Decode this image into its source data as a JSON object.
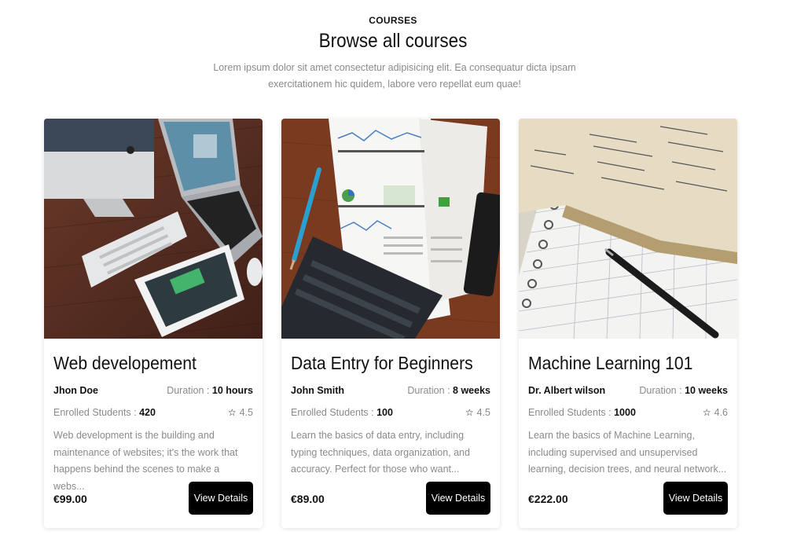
{
  "header": {
    "eyebrow": "COURSES",
    "title": "Browse all courses",
    "subtitle": "Lorem ipsum dolor sit amet consectetur adipisicing elit. Ea consequatur dicta ipsam exercitationem hic quidem, labore vero repellat eum quae!"
  },
  "labels": {
    "duration": "Duration :",
    "enrolled": "Enrolled Students :",
    "button": "View Details"
  },
  "courses": [
    {
      "title": "Web developement",
      "instructor": "Jhon Doe",
      "duration": "10 hours",
      "enrolled": "420",
      "rating": "4.5",
      "description": "Web development is the building and maintenance of websites; it's the work that happens behind the scenes to make a webs...",
      "price": "€99.00",
      "image_icon": "desk-computers-image"
    },
    {
      "title": "Data Entry for Beginners",
      "instructor": "John Smith",
      "duration": "8 weeks",
      "enrolled": "100",
      "rating": "4.5",
      "description": "Learn the basics of data entry, including typing techniques, data organization, and accuracy. Perfect for those who want...",
      "price": "€89.00",
      "image_icon": "analytics-desk-image"
    },
    {
      "title": "Machine Learning 101",
      "instructor": "Dr. Albert wilson",
      "duration": "10 weeks",
      "enrolled": "1000",
      "rating": "4.6",
      "description": "Learn the basics of Machine Learning, including supervised and unsupervised learning, decision trees, and neural network...",
      "price": "€222.00",
      "image_icon": "notebook-pen-image"
    }
  ]
}
